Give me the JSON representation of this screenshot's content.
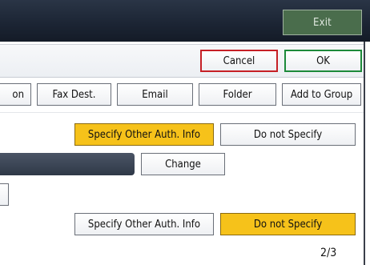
{
  "header": {
    "exit_label": "Exit"
  },
  "actions": {
    "cancel_label": "Cancel",
    "ok_label": "OK"
  },
  "tabs": [
    {
      "label": "on"
    },
    {
      "label": "Fax Dest."
    },
    {
      "label": "Email"
    },
    {
      "label": "Folder"
    },
    {
      "label": "Add to Group"
    }
  ],
  "row1": {
    "specify_label": "Specify Other Auth. Info",
    "do_not_label": "Do not Specify",
    "selected": "specify"
  },
  "row2": {
    "change_label": "Change"
  },
  "row3": {
    "specify_label": "Specify Other Auth. Info",
    "do_not_label": "Do not Specify",
    "selected": "do_not"
  },
  "pagination": {
    "text": "2/3"
  },
  "colors": {
    "selected": "#f6c21a",
    "cancel_border": "#c62026",
    "ok_border": "#1d8a3a",
    "topbar": "#1b2433",
    "exit_button": "#4a6d4c"
  }
}
